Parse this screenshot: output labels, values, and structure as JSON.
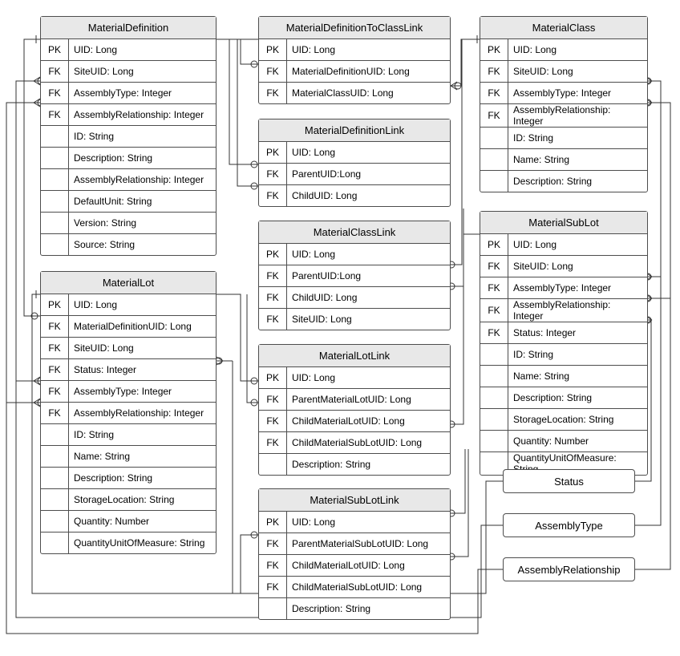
{
  "entities": {
    "materialDefinition": {
      "title": "MaterialDefinition",
      "rows": [
        {
          "key": "PK",
          "val": "UID: Long"
        },
        {
          "key": "FK",
          "val": "SiteUID: Long"
        },
        {
          "key": "FK",
          "val": "AssemblyType: Integer"
        },
        {
          "key": "FK",
          "val": "AssemblyRelationship: Integer"
        },
        {
          "key": "",
          "val": "ID: String"
        },
        {
          "key": "",
          "val": "Description: String"
        },
        {
          "key": "",
          "val": "AssemblyRelationship: Integer"
        },
        {
          "key": "",
          "val": "DefaultUnit: String"
        },
        {
          "key": "",
          "val": "Version: String"
        },
        {
          "key": "",
          "val": "Source: String"
        }
      ]
    },
    "materialDefinitionToClassLink": {
      "title": "MaterialDefinitionToClassLink",
      "rows": [
        {
          "key": "PK",
          "val": "UID: Long"
        },
        {
          "key": "FK",
          "val": "MaterialDefinitionUID: Long"
        },
        {
          "key": "FK",
          "val": "MaterialClassUID: Long"
        }
      ]
    },
    "materialDefinitionLink": {
      "title": "MaterialDefinitionLink",
      "rows": [
        {
          "key": "PK",
          "val": "UID: Long"
        },
        {
          "key": "FK",
          "val": "ParentUID:Long"
        },
        {
          "key": "FK",
          "val": "ChildUID: Long"
        }
      ]
    },
    "materialClass": {
      "title": "MaterialClass",
      "rows": [
        {
          "key": "PK",
          "val": "UID: Long"
        },
        {
          "key": "FK",
          "val": "SiteUID: Long"
        },
        {
          "key": "FK",
          "val": "AssemblyType: Integer"
        },
        {
          "key": "FK",
          "val": "AssemblyRelationship: Integer"
        },
        {
          "key": "",
          "val": "ID: String"
        },
        {
          "key": "",
          "val": "Name: String"
        },
        {
          "key": "",
          "val": "Description: String"
        }
      ]
    },
    "materialSubLot": {
      "title": "MaterialSubLot",
      "rows": [
        {
          "key": "PK",
          "val": "UID: Long"
        },
        {
          "key": "FK",
          "val": "SiteUID: Long"
        },
        {
          "key": "FK",
          "val": "AssemblyType: Integer"
        },
        {
          "key": "FK",
          "val": "AssemblyRelationship: Integer"
        },
        {
          "key": "FK",
          "val": "Status: Integer"
        },
        {
          "key": "",
          "val": "ID: String"
        },
        {
          "key": "",
          "val": "Name: String"
        },
        {
          "key": "",
          "val": "Description: String"
        },
        {
          "key": "",
          "val": "StorageLocation: String"
        },
        {
          "key": "",
          "val": "Quantity: Number"
        },
        {
          "key": "",
          "val": "QuantityUnitOfMeasure: String"
        }
      ]
    },
    "materialLot": {
      "title": "MaterialLot",
      "rows": [
        {
          "key": "PK",
          "val": "UID: Long"
        },
        {
          "key": "FK",
          "val": "MaterialDefinitionUID: Long"
        },
        {
          "key": "FK",
          "val": "SiteUID: Long"
        },
        {
          "key": "FK",
          "val": "Status: Integer"
        },
        {
          "key": "FK",
          "val": "AssemblyType: Integer"
        },
        {
          "key": "FK",
          "val": "AssemblyRelationship: Integer"
        },
        {
          "key": "",
          "val": "ID: String"
        },
        {
          "key": "",
          "val": "Name: String"
        },
        {
          "key": "",
          "val": "Description: String"
        },
        {
          "key": "",
          "val": "StorageLocation: String"
        },
        {
          "key": "",
          "val": "Quantity: Number"
        },
        {
          "key": "",
          "val": "QuantityUnitOfMeasure: String"
        }
      ]
    },
    "materialClassLink": {
      "title": "MaterialClassLink",
      "rows": [
        {
          "key": "PK",
          "val": "UID: Long"
        },
        {
          "key": "FK",
          "val": "ParentUID:Long"
        },
        {
          "key": "FK",
          "val": "ChildUID: Long"
        },
        {
          "key": "FK",
          "val": "SiteUID: Long"
        }
      ]
    },
    "materialLotLink": {
      "title": "MaterialLotLink",
      "rows": [
        {
          "key": "PK",
          "val": "UID: Long"
        },
        {
          "key": "FK",
          "val": "ParentMaterialLotUID: Long"
        },
        {
          "key": "FK",
          "val": "ChildMaterialLotUID: Long"
        },
        {
          "key": "FK",
          "val": "ChildMaterialSubLotUID: Long"
        },
        {
          "key": "",
          "val": "Description: String"
        }
      ]
    },
    "materialSubLotLink": {
      "title": "MaterialSubLotLink",
      "rows": [
        {
          "key": "PK",
          "val": "UID: Long"
        },
        {
          "key": "FK",
          "val": "ParentMaterialSubLotUID: Long"
        },
        {
          "key": "FK",
          "val": "ChildMaterialLotUID: Long"
        },
        {
          "key": "FK",
          "val": "ChildMaterialSubLotUID: Long"
        },
        {
          "key": "",
          "val": "Description: String"
        }
      ]
    }
  },
  "lookups": {
    "status": "Status",
    "assemblyType": "AssemblyType",
    "assemblyRelationship": "AssemblyRelationship"
  }
}
